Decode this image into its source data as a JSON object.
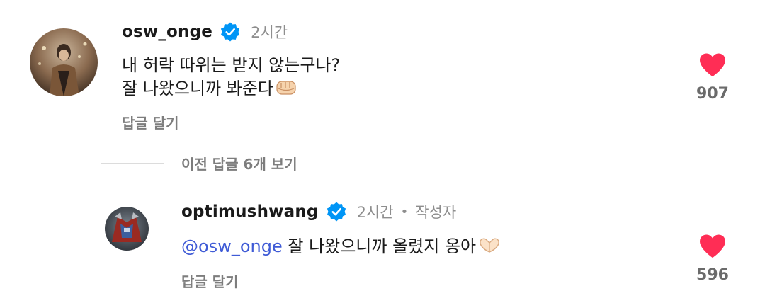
{
  "comments": [
    {
      "username": "osw_onge",
      "verified": true,
      "time": "2시간",
      "text_lines": [
        "내 허락 따위는 받지 않는구나?",
        "잘 나왔으니까 봐준다"
      ],
      "emoji": "fist-emoji",
      "reply_label": "답글 달기",
      "likes": "907",
      "liked": true
    },
    {
      "username": "optimushwang",
      "verified": true,
      "time": "2시간",
      "author_tag": "작성자",
      "mention": "@osw_onge",
      "text": "잘 나왔으니까 올렸지 옹아",
      "emoji": "heart-hands-emoji",
      "reply_label": "답글 달기",
      "likes": "596",
      "liked": true
    }
  ],
  "previous_replies_label": "이전 답글 6개 보기",
  "colors": {
    "heart": "#ff2d55",
    "verified": "#0095f6",
    "mention": "#3f5bd6",
    "muted": "#8e8e8e"
  }
}
